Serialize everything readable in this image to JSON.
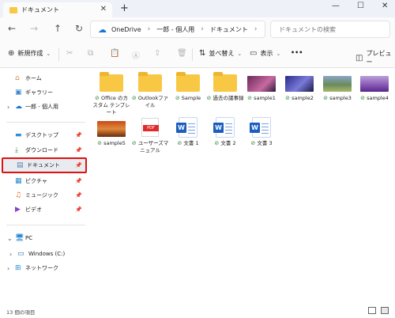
{
  "window": {
    "tab_title": "ドキュメント",
    "tab_close": "✕",
    "new_tab": "+",
    "minimize": "—",
    "maximize": "☐",
    "close": "✕"
  },
  "nav": {
    "back": "←",
    "forward": "→",
    "up": "↑",
    "refresh": "↻",
    "breadcrumb": [
      "OneDrive",
      "一郎 - 個人用",
      "ドキュメント"
    ],
    "breadcrumb_sep": "›",
    "search_placeholder": "ドキュメントの検索"
  },
  "toolbar": {
    "new_label": "新規作成",
    "sort_label": "並べ替え",
    "view_label": "表示",
    "more_label": "•••",
    "preview_label": "プレビュー"
  },
  "sidebar": {
    "top": [
      {
        "label": "ホーム",
        "icon": "home-icon"
      },
      {
        "label": "ギャラリー",
        "icon": "gallery-icon"
      },
      {
        "label": "一郎 - 個人用",
        "icon": "onedrive-icon"
      }
    ],
    "quick": [
      {
        "label": "デスクトップ",
        "icon": "desktop-icon"
      },
      {
        "label": "ダウンロード",
        "icon": "download-icon"
      },
      {
        "label": "ドキュメント",
        "icon": "documents-icon",
        "selected": true
      },
      {
        "label": "ピクチャ",
        "icon": "pictures-icon"
      },
      {
        "label": "ミュージック",
        "icon": "music-icon"
      },
      {
        "label": "ビデオ",
        "icon": "video-icon"
      }
    ],
    "pc": [
      {
        "label": "PC",
        "icon": "pc-icon"
      },
      {
        "label": "Windows (C:)",
        "icon": "drive-icon"
      },
      {
        "label": "ネットワーク",
        "icon": "network-icon"
      }
    ]
  },
  "files": [
    {
      "name": "Office のカスタム テンプレート",
      "type": "folder"
    },
    {
      "name": "Outlookファイル",
      "type": "folder"
    },
    {
      "name": "Sample",
      "type": "folder"
    },
    {
      "name": "過去の議事録",
      "type": "folder"
    },
    {
      "name": "sample1",
      "type": "image"
    },
    {
      "name": "sample2",
      "type": "image"
    },
    {
      "name": "sample3",
      "type": "image"
    },
    {
      "name": "sample4",
      "type": "image"
    },
    {
      "name": "sample5",
      "type": "image"
    },
    {
      "name": "ユーザーズマニュアル",
      "type": "pdf"
    },
    {
      "name": "文書 1",
      "type": "word"
    },
    {
      "name": "文書 2",
      "type": "word"
    },
    {
      "name": "文書 3",
      "type": "word"
    }
  ],
  "pdf_badge": "PDF",
  "word_badge": "W",
  "sync_check": "⊘",
  "status": {
    "count": "13 個の項目"
  },
  "colors": {
    "selection_border": "#e01010",
    "folder": "#f8c844",
    "onedrive": "#1677d6",
    "sync_ok": "#2e8b3c",
    "word": "#1b5ebf",
    "pdf": "#e02b2b"
  }
}
